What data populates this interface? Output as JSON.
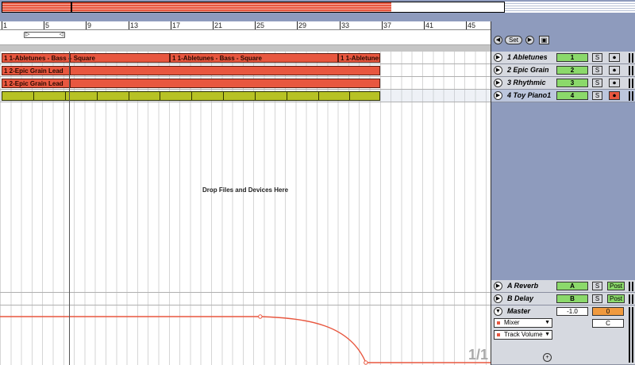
{
  "colors": {
    "background": "#8e9bbd",
    "clip_red": "#e8573f",
    "clip_green": "#b7c225",
    "active_green": "#8bd96b",
    "arm_red": "#e8573f"
  },
  "ruler": {
    "bars": [
      "1",
      "5",
      "9",
      "13",
      "17",
      "21",
      "25",
      "29",
      "33",
      "37",
      "41",
      "45"
    ]
  },
  "session": {
    "set_label": "Set",
    "back_icon": "arrow-left-icon",
    "forward_icon": "arrow-right-icon",
    "extra_icon": "save-icon"
  },
  "tracks": [
    {
      "name": "1 Abletunes",
      "number": "1",
      "solo": "S",
      "arm_active": false,
      "clips": [
        "1 1-Abletunes - Bass - Square",
        "1 1-Abletunes - Bass - Square",
        "1 1-Abletunes - Bass - Square"
      ]
    },
    {
      "name": "2 Epic Grain",
      "number": "2",
      "solo": "S",
      "arm_active": false,
      "clips": [
        "1 2-Epic Grain Lead"
      ]
    },
    {
      "name": "3 Rhythmic",
      "number": "3",
      "solo": "S",
      "arm_active": false,
      "clips": [
        "1 2-Epic Grain Lead"
      ]
    },
    {
      "name": "4 Toy Piano1",
      "number": "4",
      "solo": "S",
      "arm_active": true,
      "clips": []
    }
  ],
  "clip_labels": {
    "t1_a": "1 1-Abletunes - Bass - Square",
    "t1_b": "1 1-Abletunes - Bass - Square",
    "t1_c": "1 1-Abletunes - Bass - Square",
    "t2": "1 2-Epic Grain Lead",
    "t3": "1 2-Epic Grain Lead"
  },
  "drop_text": "Drop Files and Devices Here",
  "returns": [
    {
      "name": "A Reverb",
      "letter": "A",
      "solo": "S",
      "post": "Post"
    },
    {
      "name": "B Delay",
      "letter": "B",
      "solo": "S",
      "post": "Post"
    }
  ],
  "master": {
    "name": "Master",
    "volume": "-1.0",
    "send_value": "0",
    "pan": "C",
    "device_chooser": "Mixer",
    "parameter_chooser": "Track Volume",
    "automation_levels": {
      "start": 1.0,
      "breakpoint_bar": 25.5,
      "end_bar": 35.5,
      "end": 0.0
    }
  },
  "page_indicator": "1/1"
}
